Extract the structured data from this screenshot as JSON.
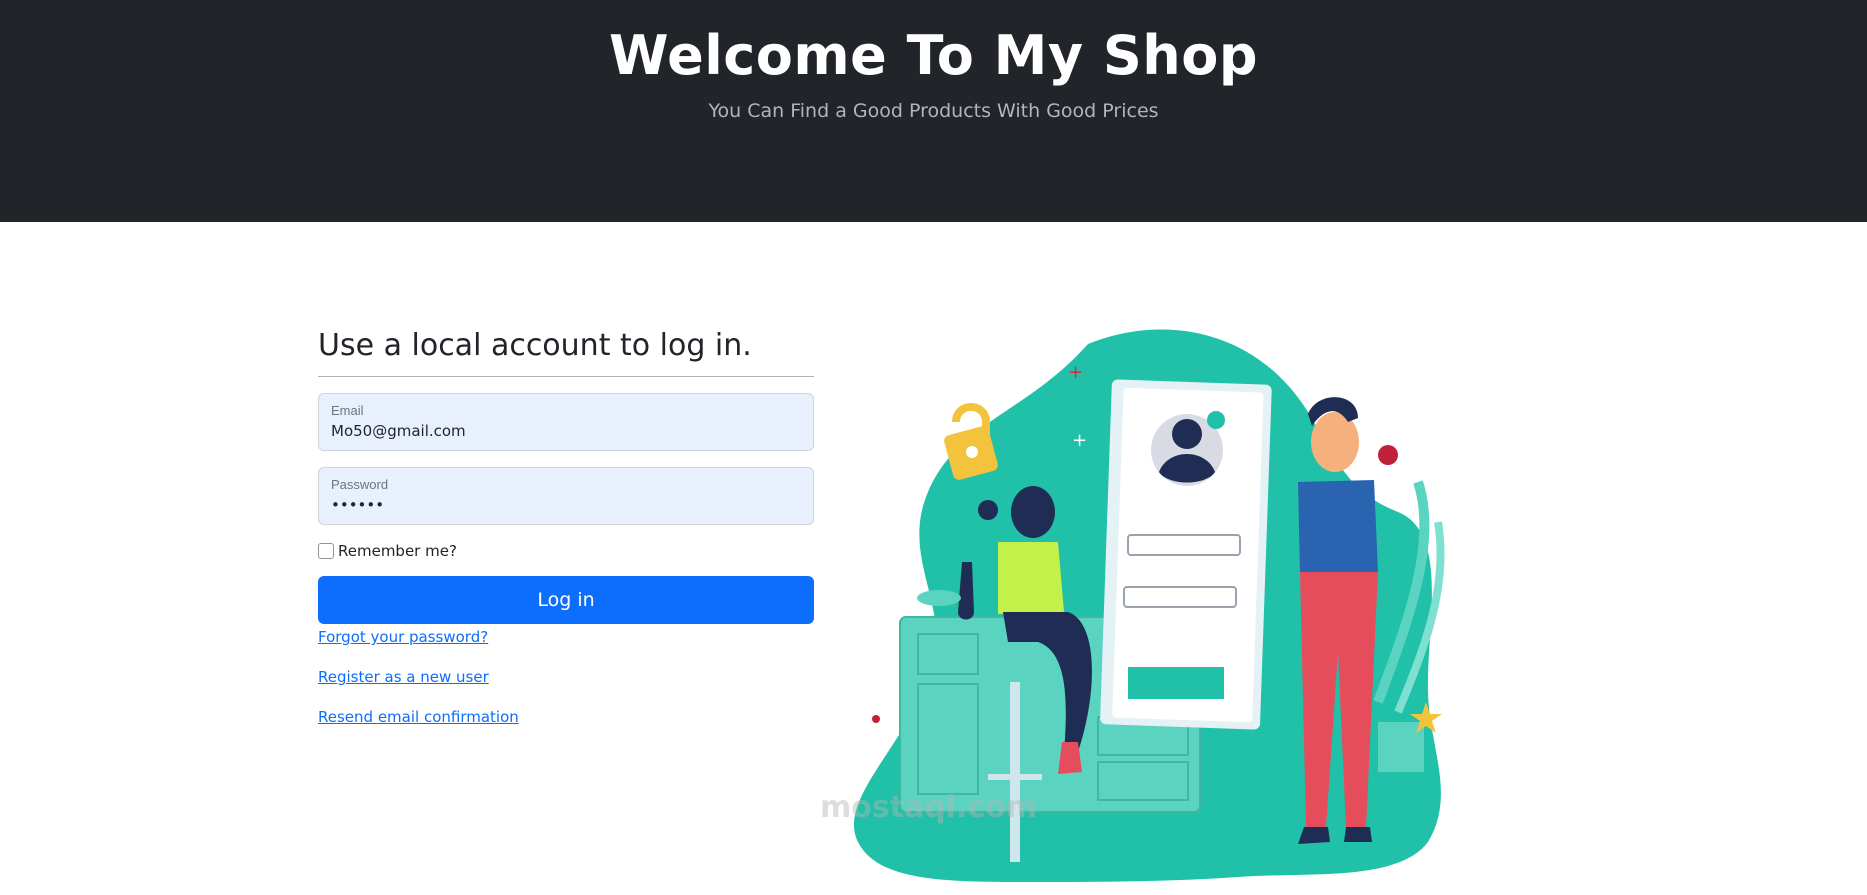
{
  "header": {
    "title": "Welcome To My Shop",
    "subtitle": "You Can Find a Good Products With Good Prices"
  },
  "login": {
    "heading": "Use a local account to log in.",
    "email_label": "Email",
    "email_value": "Mo50@gmail.com",
    "password_label": "Password",
    "password_value": "••••••",
    "remember_label": "Remember me?",
    "submit_label": "Log in",
    "links": {
      "forgot": "Forgot your password?",
      "register": "Register as a new user",
      "resend": "Resend email confirmation"
    }
  },
  "illustration": {
    "icon": "login-illustration-icon",
    "watermark_text": "mostaql.com"
  },
  "colors": {
    "header_bg": "#212529",
    "primary": "#0d6efd",
    "teal": "#20c1a8",
    "input_bg": "#e8f0fe"
  }
}
